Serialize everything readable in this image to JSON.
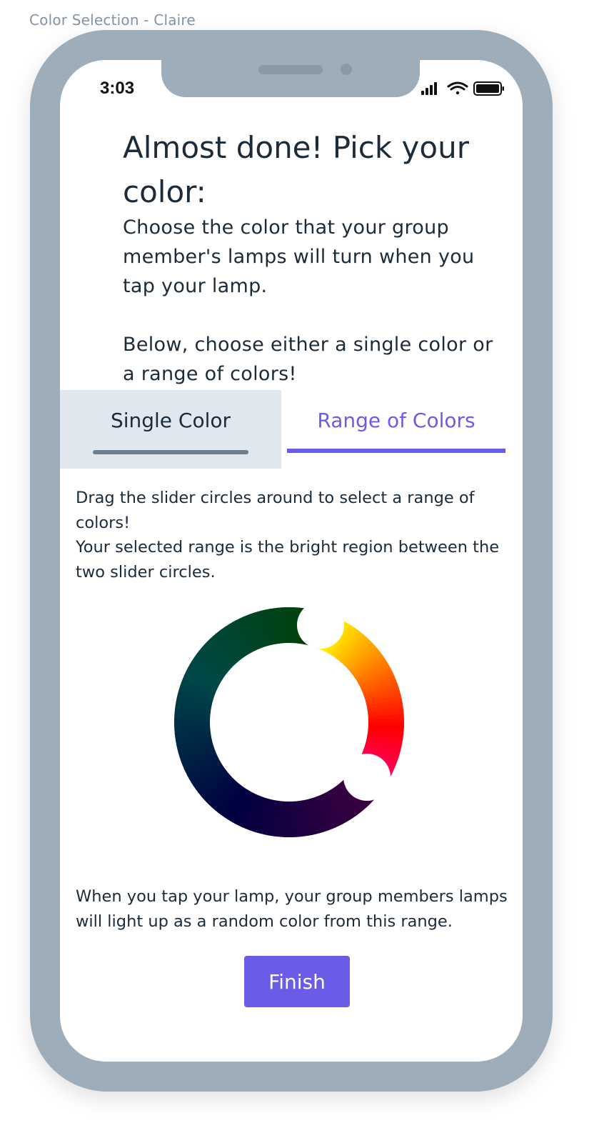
{
  "frame": {
    "title": "Color Selection - Claire"
  },
  "status_bar": {
    "time": "3:03",
    "icons": [
      "cellular-signal-icon",
      "wifi-icon",
      "battery-icon"
    ]
  },
  "header": {
    "title": "Almost done! Pick your color:",
    "description": "Choose the color that your group member's lamps will turn when you tap your lamp.",
    "prompt": "Below, choose either a single color or a range of colors!"
  },
  "tabs": [
    {
      "label": "Single Color",
      "selected": false
    },
    {
      "label": "Range of Colors",
      "selected": true
    }
  ],
  "range_panel": {
    "instruction_1": "Drag the slider circles around to select a range of colors!",
    "instruction_2": "Your selected range is the bright region between the two slider circles.",
    "color_wheel": {
      "selected_range_colors": [
        "#ffff00",
        "#ff8000",
        "#ff0000",
        "#ff0080"
      ],
      "unselected_range_colors": [
        "#004000",
        "#004848",
        "#000040",
        "#400040"
      ]
    },
    "result_text": "When you tap your lamp, your group members lamps will light up as a random color from this range."
  },
  "actions": {
    "finish_label": "Finish"
  },
  "colors": {
    "accent": "#6b5ce7",
    "phone_frame": "#9eadba",
    "text": "#1c2b3a",
    "inactive_tab_bg": "#e1e7ef"
  }
}
